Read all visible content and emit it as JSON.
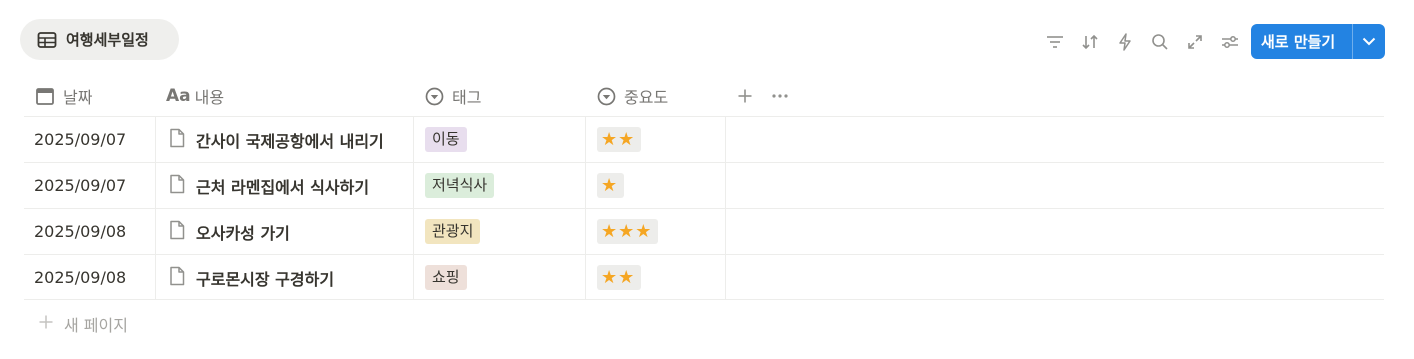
{
  "view": {
    "name": "여행세부일정",
    "icon": "table-icon"
  },
  "toolbar": {
    "icons": [
      "filter-icon",
      "sort-icon",
      "automation-icon",
      "search-icon",
      "expand-icon",
      "settings-icon"
    ],
    "new_button_label": "새로 만들기"
  },
  "columns": [
    {
      "label": "날짜",
      "icon": "calendar-icon"
    },
    {
      "label": "내용",
      "icon": "text-aa-icon"
    },
    {
      "label": "태그",
      "icon": "select-icon"
    },
    {
      "label": "중요도",
      "icon": "select-icon"
    }
  ],
  "rows": [
    {
      "date": "2025/09/07",
      "title": "간사이 국제공항에서 내리기",
      "tag": "이동",
      "tag_color": "#e8deee",
      "stars": "★★"
    },
    {
      "date": "2025/09/07",
      "title": "근처 라멘집에서 식사하기",
      "tag": "저녁식사",
      "tag_color": "#dbeddb",
      "stars": "★"
    },
    {
      "date": "2025/09/08",
      "title": "오사카성 가기",
      "tag": "관광지",
      "tag_color": "#f2e5bf",
      "stars": "★★★"
    },
    {
      "date": "2025/09/08",
      "title": "구로몬시장 구경하기",
      "tag": "쇼핑",
      "tag_color": "#eee0da",
      "stars": "★★"
    }
  ],
  "new_page_label": "새 페이지",
  "colors": {
    "accent": "#2383e2",
    "star": "#f5a623",
    "muted": "#787774"
  }
}
